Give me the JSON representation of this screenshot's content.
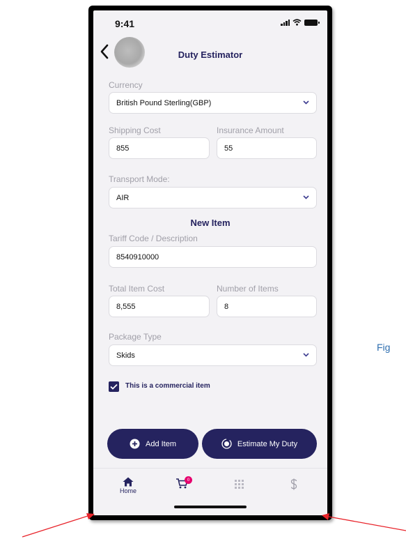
{
  "status_bar": {
    "time": "9:41"
  },
  "header": {
    "title": "Duty Estimator"
  },
  "form": {
    "currency": {
      "label": "Currency",
      "value": "British Pound Sterling(GBP)"
    },
    "shipping_cost": {
      "label": "Shipping Cost",
      "value": "855"
    },
    "insurance_amount": {
      "label": "Insurance Amount",
      "value": "55"
    },
    "transport_mode": {
      "label": "Transport Mode:",
      "value": "AIR"
    },
    "section_title": "New Item",
    "tariff_code": {
      "label": "Tariff Code / Description",
      "value": "8540910000"
    },
    "total_item_cost": {
      "label": "Total Item Cost",
      "value": "8,555"
    },
    "number_of_items": {
      "label": "Number of Items",
      "value": "8"
    },
    "package_type": {
      "label": "Package Type",
      "value": "Skids"
    },
    "commercial_item": {
      "label": "This is a commercial item",
      "checked": true
    }
  },
  "buttons": {
    "add_item": "Add Item",
    "estimate": "Estimate My Duty"
  },
  "nav": {
    "home_label": "Home",
    "cart_badge": "0",
    "icons": [
      "home-icon",
      "cart-icon",
      "grid-icon",
      "dollar-icon"
    ]
  },
  "annotation": {
    "fig_label": "Fig"
  },
  "colors": {
    "primary": "#25235f",
    "badge": "#e6006e",
    "background": "#f3f2f5",
    "arrow": "#e8232a"
  }
}
